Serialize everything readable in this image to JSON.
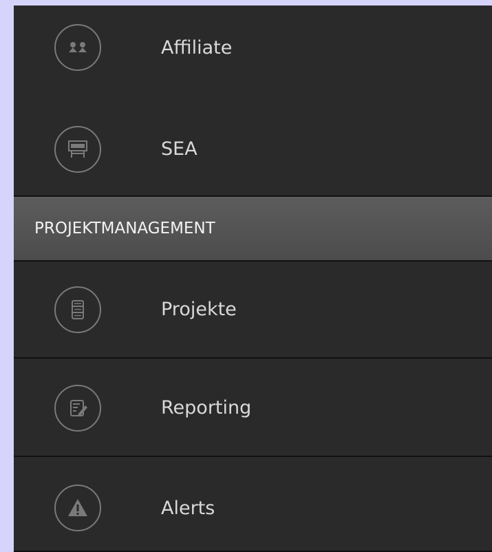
{
  "colors": {
    "background": "#d6d4fb",
    "sidebar": "#2a2a2a",
    "section_header": "#555555",
    "item_text": "#d9d9d9",
    "icon_stroke": "#7a7a7a"
  },
  "sidebar": {
    "items": [
      {
        "label": "Affiliate",
        "icon": "affiliate-people-icon"
      },
      {
        "label": "SEA",
        "icon": "sea-sign-icon"
      }
    ],
    "section": {
      "label": "PROJEKTMANAGEMENT",
      "items": [
        {
          "label": "Projekte",
          "icon": "projects-document-icon"
        },
        {
          "label": "Reporting",
          "icon": "reporting-edit-icon"
        },
        {
          "label": "Alerts",
          "icon": "alert-warning-icon"
        }
      ]
    }
  }
}
